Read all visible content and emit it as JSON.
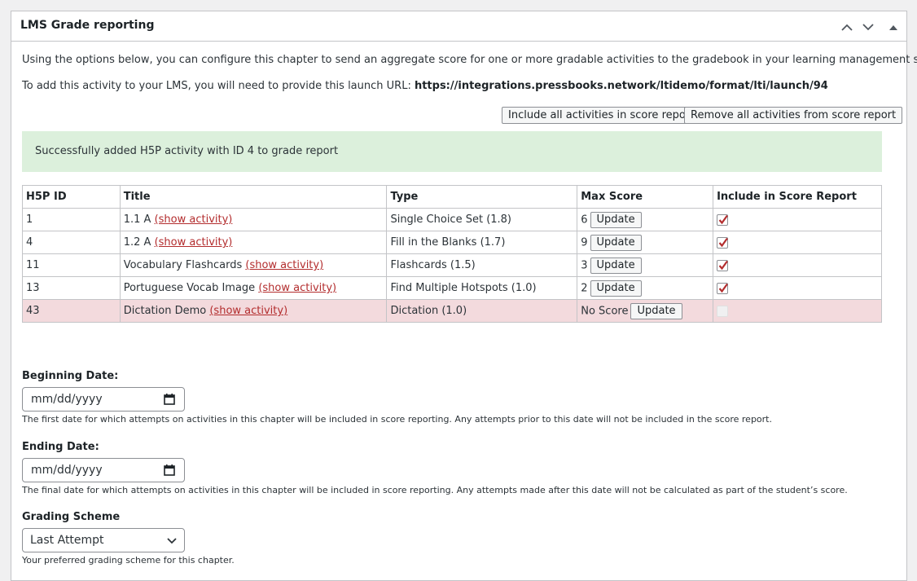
{
  "panel": {
    "title": "LMS Grade reporting"
  },
  "intro_text": "Using the options below, you can configure this chapter to send an aggregate score for one or more gradable activities to the gradebook in your learning management system.",
  "launch": {
    "prefix": "To add this activity to your LMS, you will need to provide this launch URL: ",
    "url": "https://integrations.pressbooks.network/ltidemo/format/lti/launch/94"
  },
  "buttons": {
    "include_all": "Include all activities in score report",
    "remove_all": "Remove all activities from score report"
  },
  "notice": "Successfully added H5P activity with ID 4 to grade report",
  "table": {
    "headers": [
      "H5P ID",
      "Title",
      "Type",
      "Max Score",
      "Include in Score Report"
    ],
    "show_link": "(show activity)",
    "update_label": "Update",
    "rows": [
      {
        "id": "1",
        "title": "1.1 A",
        "type": "Single Choice Set (1.8)",
        "max": "6",
        "included": true
      },
      {
        "id": "4",
        "title": "1.2 A",
        "type": "Fill in the Blanks (1.7)",
        "max": "9",
        "included": true
      },
      {
        "id": "11",
        "title": "Vocabulary Flashcards",
        "type": "Flashcards (1.5)",
        "max": "3",
        "included": true
      },
      {
        "id": "13",
        "title": "Portuguese Vocab Image",
        "type": "Find Multiple Hotspots (1.0)",
        "max": "2",
        "included": true
      },
      {
        "id": "43",
        "title": "Dictation Demo",
        "type": "Dictation (1.0)",
        "max": "No Score",
        "included": false
      }
    ]
  },
  "beginning": {
    "label": "Beginning Date:",
    "placeholder": "mm/dd/yyyy",
    "help": "The first date for which attempts on activities in this chapter will be included in score reporting. Any attempts prior to this date will not be included in the score report."
  },
  "ending": {
    "label": "Ending Date:",
    "placeholder": "mm/dd/yyyy",
    "help": "The final date for which attempts on activities in this chapter will be included in score reporting. Any attempts made after this date will not be calculated as part of the student’s score."
  },
  "grading": {
    "label": "Grading Scheme",
    "selected": "Last Attempt",
    "help": "Your preferred grading scheme for this chapter."
  },
  "colors": {
    "notice_bg": "#dcf0dc",
    "noscore_row_bg": "#f3dadd",
    "link": "#b32d2e",
    "check": "#b32d2e"
  }
}
